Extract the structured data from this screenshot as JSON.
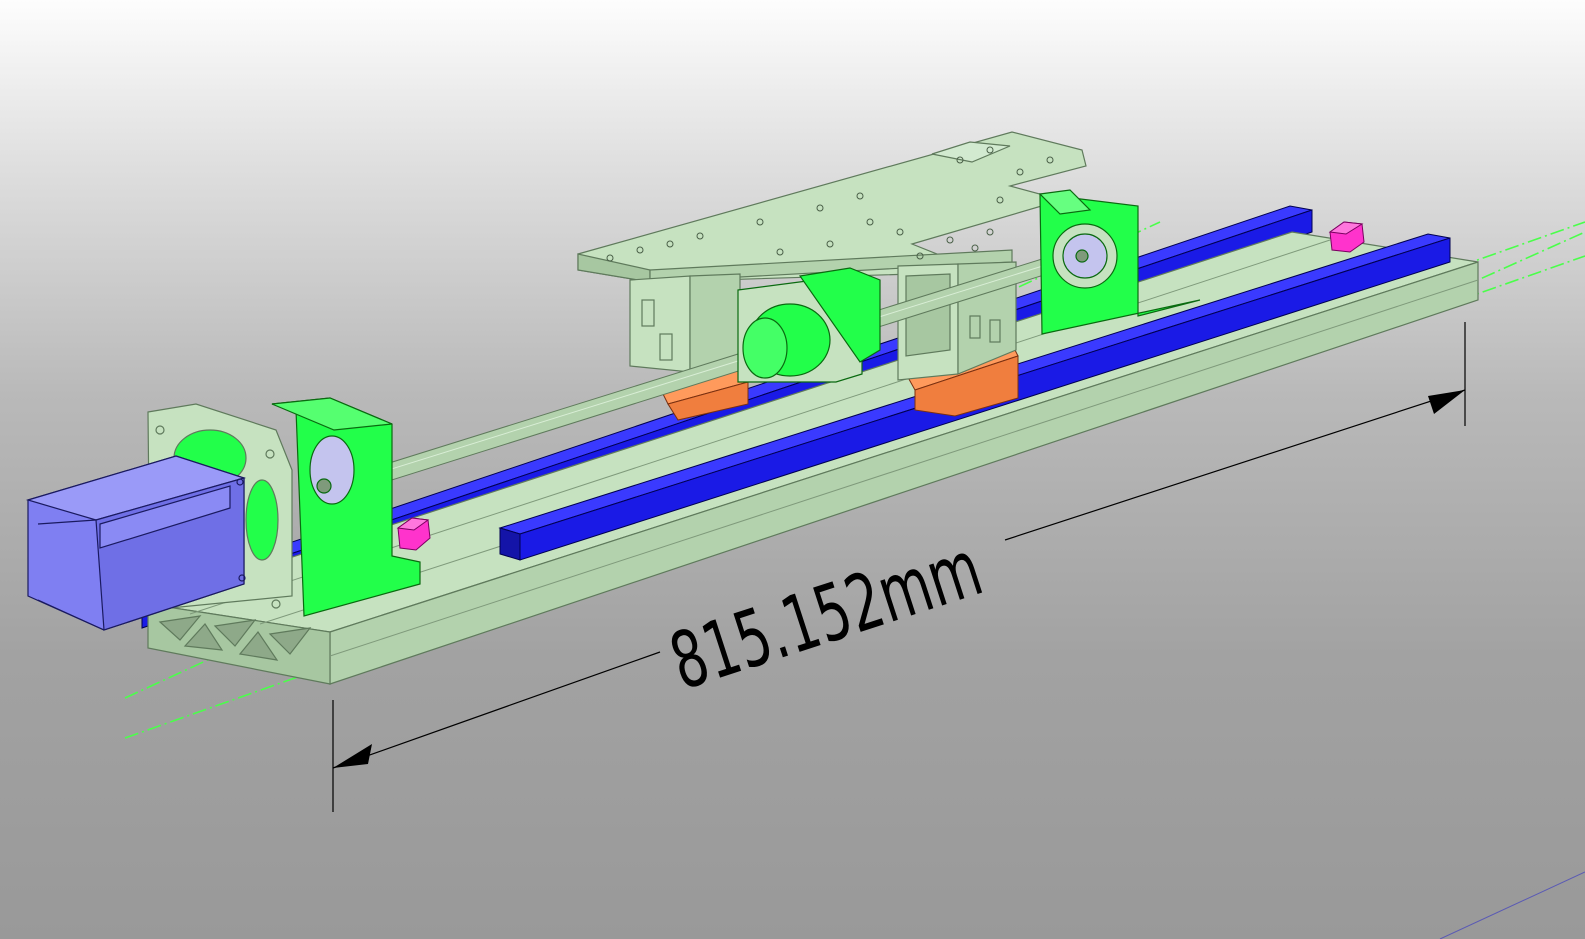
{
  "viewport": {
    "background_top": "#fdfdfd",
    "background_bottom": "#999999"
  },
  "dimension": {
    "label": "815.152mm",
    "color": "#000000"
  },
  "colors": {
    "frame": "#b9d9b3",
    "frame_edge": "#5f7a5c",
    "bracket": "#22ff4a",
    "rail": "#1a1ae6",
    "motor": "#7f7ff2",
    "bearing_block": "#f07e3e",
    "bolt": "#ff33cc",
    "bearing_face": "#c4c4ee",
    "axis_line": "#4aff4a"
  }
}
